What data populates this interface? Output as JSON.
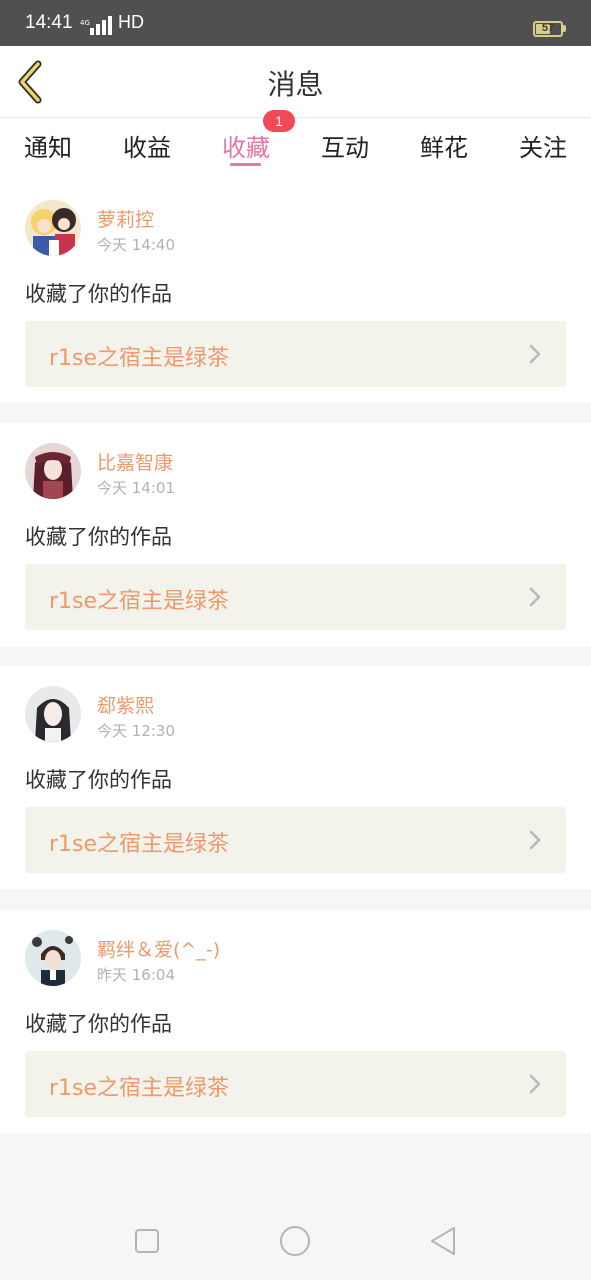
{
  "status_bar": {
    "time": "14:41",
    "network": "4G",
    "hd": "HD",
    "battery": "57"
  },
  "header": {
    "title": "消息"
  },
  "tabs": [
    {
      "label": "通知",
      "active": false
    },
    {
      "label": "收益",
      "active": false
    },
    {
      "label": "收藏",
      "active": true,
      "badge": "1"
    },
    {
      "label": "互动",
      "active": false
    },
    {
      "label": "鲜花",
      "active": false
    },
    {
      "label": "关注",
      "active": false
    }
  ],
  "messages": [
    {
      "username": "萝莉控",
      "time": "今天 14:40",
      "action": "收藏了你的作品",
      "work": "r1se之宿主是绿茶"
    },
    {
      "username": "比嘉智康",
      "time": "今天 14:01",
      "action": "收藏了你的作品",
      "work": "r1se之宿主是绿茶"
    },
    {
      "username": "郄紫熙",
      "time": "今天 12:30",
      "action": "收藏了你的作品",
      "work": "r1se之宿主是绿茶"
    },
    {
      "username": "羁绊＆爱(^_-)",
      "time": "昨天 16:04",
      "action": "收藏了你的作品",
      "work": "r1se之宿主是绿茶"
    }
  ],
  "colors": {
    "accent": "#e276a8",
    "name": "#ec9a6b",
    "badge": "#f04a55"
  }
}
